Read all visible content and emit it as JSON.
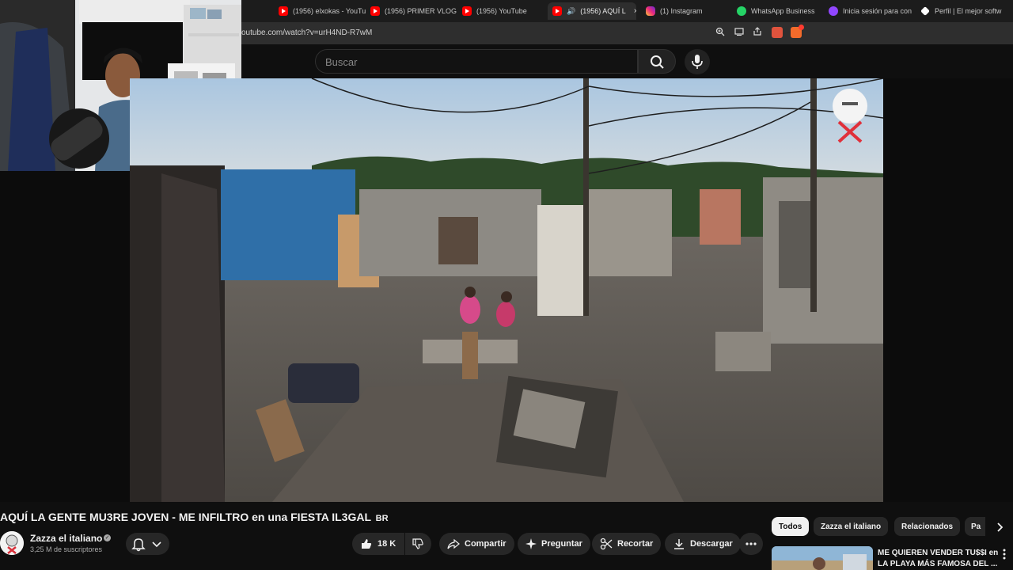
{
  "browser": {
    "tabs": [
      {
        "label": "(1956) elxokas - YouTu",
        "icon": "youtube-icon"
      },
      {
        "label": "(1956) PRIMER VLOG",
        "icon": "youtube-icon"
      },
      {
        "label": "(1956) YouTube",
        "icon": "youtube-icon"
      },
      {
        "label": "(1956) AQUÍ L",
        "icon": "youtube-icon",
        "active": true
      },
      {
        "label": "(1) Instagram",
        "icon": "instagram-icon"
      },
      {
        "label": "WhatsApp Business",
        "icon": "whatsapp-icon"
      },
      {
        "label": "Inicia sesión para con",
        "icon": "twitch-icon"
      },
      {
        "label": "Perfil | El mejor softw",
        "icon": "profile-icon"
      }
    ],
    "tab_close": "×",
    "url": "outube.com/watch?v=urH4ND-R7wM"
  },
  "youtube": {
    "search_placeholder": "Buscar",
    "video_title": "AQUÍ LA GENTE MU3RE JOVEN - ME INFILTRO en una FIESTA IL3GAL",
    "title_suffix": "BR",
    "channel_name": "Zazza el italiano",
    "verified_mark": "✓",
    "subscribers": "3,25 M de suscriptores",
    "like_count": "18 K",
    "actions": {
      "share": "Compartir",
      "thanks": "Preguntar",
      "clip": "Recortar",
      "download": "Descargar"
    },
    "chips": [
      "Todos",
      "Zazza el italiano",
      "Relacionados",
      "Pa"
    ],
    "recommended": {
      "title": "ME QUIEREN VENDER TU$$I en LA PLAYA MÁS FAMOSA DEL ..."
    }
  },
  "colors": {
    "background": "#0f0f0f",
    "surface": "#272727",
    "tab_bar": "#1c1c1c",
    "youtube_red": "#ff0000"
  }
}
